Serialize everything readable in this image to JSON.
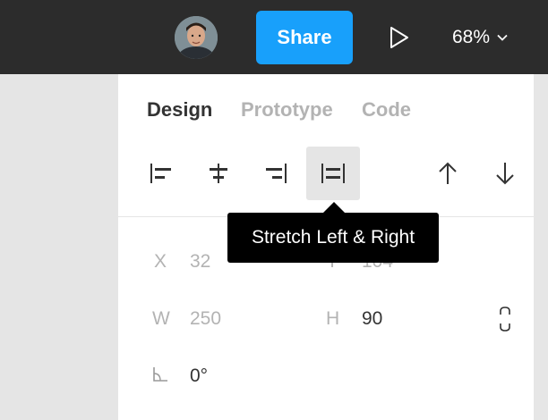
{
  "toolbar": {
    "share_label": "Share",
    "zoom_value": "68%",
    "avatar_icon": "user-avatar",
    "play_icon": "play-icon",
    "zoom_icon": "chevron-down-icon"
  },
  "panel": {
    "tabs": [
      {
        "label": "Design",
        "active": true
      },
      {
        "label": "Prototype",
        "active": false
      },
      {
        "label": "Code",
        "active": false
      }
    ],
    "alignment_icons": [
      "align-left-icon",
      "align-horizontal-center-icon",
      "align-right-icon",
      "stretch-left-right-icon",
      "arrow-up-icon",
      "arrow-down-icon"
    ],
    "tooltip": "Stretch Left & Right",
    "properties": {
      "x_label": "X",
      "x_value": "32",
      "y_label": "Y",
      "y_value": "104",
      "w_label": "W",
      "w_value": "250",
      "h_label": "H",
      "h_value": "90",
      "rotation_value": "0°",
      "constraint_icon": "constrain-proportions-icon",
      "rotation_icon": "rotation-angle-icon"
    }
  },
  "colors": {
    "topbar": "#2c2c2c",
    "accent": "#18a0fb",
    "canvas": "#e5e5e5",
    "panel": "#ffffff",
    "tooltip": "#000000"
  }
}
